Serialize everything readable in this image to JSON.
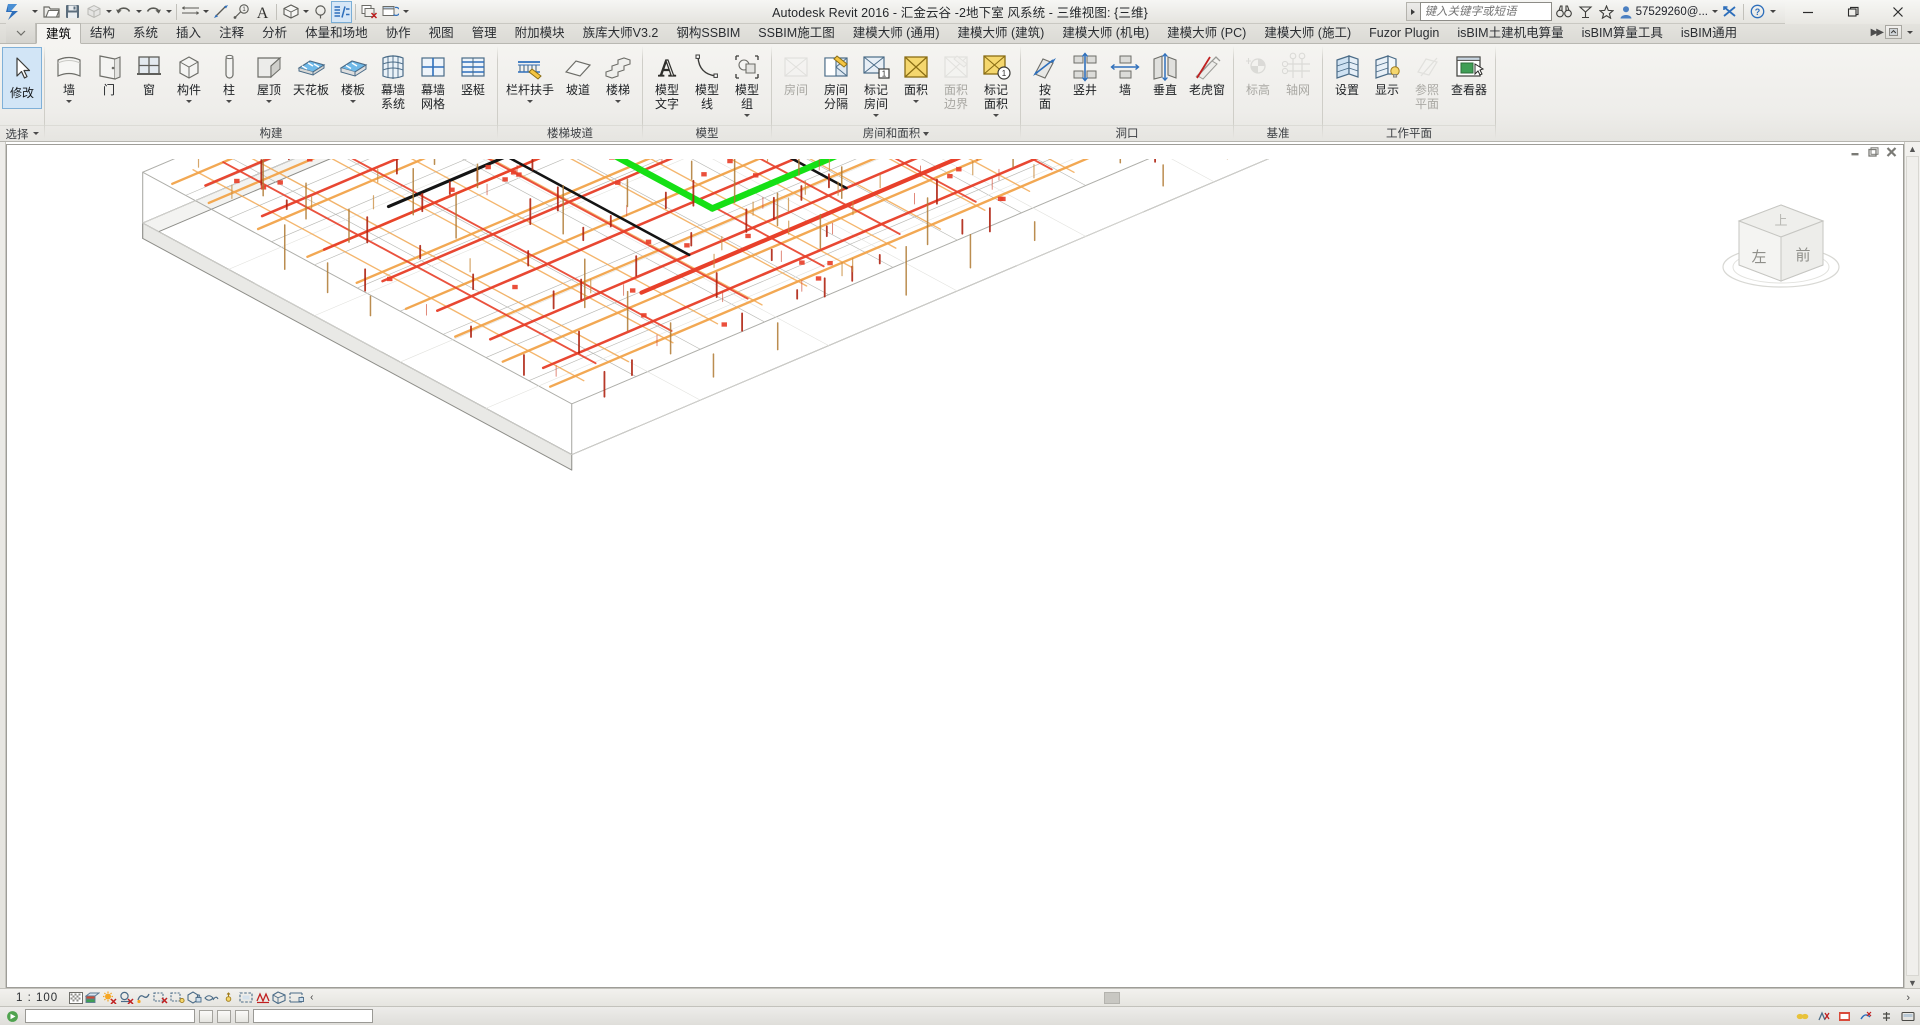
{
  "window": {
    "title": "Autodesk Revit 2016 -    汇金云谷 -2地下室  风系统 - 三维视图: {三维}",
    "app_name": "Autodesk Revit 2016",
    "document": "汇金云谷 -2地下室  风系统",
    "view": "三维视图: {三维}",
    "account": "57529260@...",
    "minimize": "—",
    "restore": "❐",
    "close": "✕"
  },
  "search": {
    "placeholder": "键入关键字或短语",
    "value": ""
  },
  "quick_access": [
    {
      "name": "open-icon",
      "label": "打开"
    },
    {
      "name": "save-icon",
      "label": "保存"
    },
    {
      "name": "export-icon",
      "label": "导出"
    },
    {
      "name": "undo-icon",
      "label": "放弃"
    },
    {
      "name": "redo-icon",
      "label": "重做"
    },
    {
      "name": "measure-icon",
      "label": "测量"
    },
    {
      "name": "aligned-dimension-icon",
      "label": "对齐尺寸标注"
    },
    {
      "name": "tag-icon",
      "label": "按类别标记"
    },
    {
      "name": "text-icon",
      "label": "文字"
    },
    {
      "name": "default-3d-view-icon",
      "label": "默认三维视图"
    },
    {
      "name": "section-icon",
      "label": "剖面"
    },
    {
      "name": "thin-lines-icon",
      "label": "细线"
    },
    {
      "name": "close-hidden-windows-icon",
      "label": "关闭隐藏窗口"
    },
    {
      "name": "switch-windows-icon",
      "label": "切换窗口"
    }
  ],
  "title_icons": [
    {
      "name": "binoculars-icon"
    },
    {
      "name": "satellite-icon"
    },
    {
      "name": "star-icon"
    },
    {
      "name": "exchange-icon"
    },
    {
      "name": "help-icon"
    }
  ],
  "tabs": [
    {
      "label": "建筑",
      "active": true
    },
    {
      "label": "结构",
      "active": false
    },
    {
      "label": "系统",
      "active": false
    },
    {
      "label": "插入",
      "active": false
    },
    {
      "label": "注释",
      "active": false
    },
    {
      "label": "分析",
      "active": false
    },
    {
      "label": "体量和场地",
      "active": false
    },
    {
      "label": "协作",
      "active": false
    },
    {
      "label": "视图",
      "active": false
    },
    {
      "label": "管理",
      "active": false
    },
    {
      "label": "附加模块",
      "active": false
    },
    {
      "label": "族库大师V3.2",
      "active": false
    },
    {
      "label": "钢构SSBIM",
      "active": false
    },
    {
      "label": "SSBIM施工图",
      "active": false
    },
    {
      "label": "建模大师 (通用)",
      "active": false
    },
    {
      "label": "建模大师 (建筑)",
      "active": false
    },
    {
      "label": "建模大师 (机电)",
      "active": false
    },
    {
      "label": "建模大师 (PC)",
      "active": false
    },
    {
      "label": "建模大师 (施工)",
      "active": false
    },
    {
      "label": "Fuzor Plugin",
      "active": false
    },
    {
      "label": "isBIM土建机电算量",
      "active": false
    },
    {
      "label": "isBIM算量工具",
      "active": false
    },
    {
      "label": "isBIM通用",
      "active": false
    }
  ],
  "select_panel": {
    "modify_label": "修改",
    "panel_title": "选择"
  },
  "ribbon_panels": [
    {
      "title": "构建",
      "buttons": [
        {
          "label": "墙",
          "icon": "wall-icon",
          "dropdown": true,
          "disabled": false
        },
        {
          "label": "门",
          "icon": "door-icon",
          "dropdown": false,
          "disabled": false
        },
        {
          "label": "窗",
          "icon": "window-icon",
          "dropdown": false,
          "disabled": false
        },
        {
          "label": "构件",
          "icon": "component-icon",
          "dropdown": true,
          "disabled": false
        },
        {
          "label": "柱",
          "icon": "column-icon",
          "dropdown": true,
          "disabled": false
        },
        {
          "label": "屋顶",
          "icon": "roof-icon",
          "dropdown": true,
          "disabled": false
        },
        {
          "label": "天花板",
          "icon": "ceiling-icon",
          "dropdown": false,
          "disabled": false
        },
        {
          "label": "楼板",
          "icon": "floor-icon",
          "dropdown": true,
          "disabled": false
        },
        {
          "label": "幕墙\n系统",
          "icon": "curtain-system-icon",
          "dropdown": false,
          "disabled": false
        },
        {
          "label": "幕墙\n网格",
          "icon": "curtain-grid-icon",
          "dropdown": false,
          "disabled": false
        },
        {
          "label": "竖梃",
          "icon": "mullion-icon",
          "dropdown": false,
          "disabled": false
        }
      ]
    },
    {
      "title": "楼梯坡道",
      "buttons": [
        {
          "label": "栏杆扶手",
          "icon": "railing-icon",
          "dropdown": true,
          "disabled": false
        },
        {
          "label": "坡道",
          "icon": "ramp-icon",
          "dropdown": false,
          "disabled": false
        },
        {
          "label": "楼梯",
          "icon": "stair-icon",
          "dropdown": true,
          "disabled": false
        }
      ]
    },
    {
      "title": "模型",
      "buttons": [
        {
          "label": "模型\n文字",
          "icon": "model-text-icon",
          "dropdown": false,
          "disabled": false
        },
        {
          "label": "模型\n线",
          "icon": "model-line-icon",
          "dropdown": false,
          "disabled": false
        },
        {
          "label": "模型\n组",
          "icon": "model-group-icon",
          "dropdown": true,
          "disabled": false
        }
      ]
    },
    {
      "title": "房间和面积",
      "has_dialog_launcher": true,
      "buttons": [
        {
          "label": "房间",
          "icon": "room-icon",
          "dropdown": false,
          "disabled": true
        },
        {
          "label": "房间\n分隔",
          "icon": "room-separator-icon",
          "dropdown": false,
          "disabled": false
        },
        {
          "label": "标记\n房间",
          "icon": "tag-room-icon",
          "dropdown": true,
          "disabled": false
        },
        {
          "label": "面积",
          "icon": "area-icon",
          "dropdown": true,
          "disabled": false
        },
        {
          "label": "面积\n边界",
          "icon": "area-boundary-icon",
          "dropdown": false,
          "disabled": true
        },
        {
          "label": "标记\n面积",
          "icon": "tag-area-icon",
          "dropdown": true,
          "disabled": false
        }
      ]
    },
    {
      "title": "洞口",
      "buttons": [
        {
          "label": "按\n面",
          "icon": "opening-by-face-icon",
          "dropdown": false,
          "disabled": false
        },
        {
          "label": "竖井",
          "icon": "shaft-icon",
          "dropdown": false,
          "disabled": false
        },
        {
          "label": "墙",
          "icon": "wall-opening-icon",
          "dropdown": false,
          "disabled": false
        },
        {
          "label": "垂直",
          "icon": "vertical-opening-icon",
          "dropdown": false,
          "disabled": false
        },
        {
          "label": "老虎窗",
          "icon": "dormer-icon",
          "dropdown": false,
          "disabled": false
        }
      ]
    },
    {
      "title": "基准",
      "buttons": [
        {
          "label": "标高",
          "icon": "level-icon",
          "dropdown": false,
          "disabled": true
        },
        {
          "label": "轴网",
          "icon": "grid-icon",
          "dropdown": false,
          "disabled": true
        }
      ]
    },
    {
      "title": "工作平面",
      "buttons": [
        {
          "label": "设置",
          "icon": "set-workplane-icon",
          "dropdown": false,
          "disabled": false
        },
        {
          "label": "显示",
          "icon": "show-workplane-icon",
          "dropdown": false,
          "disabled": false
        },
        {
          "label": "参照\n平面",
          "icon": "reference-plane-icon",
          "dropdown": false,
          "disabled": true
        },
        {
          "label": "查看器",
          "icon": "viewer-icon",
          "dropdown": false,
          "disabled": false
        }
      ]
    }
  ],
  "view_window_controls": {
    "minimize": "minimize-icon",
    "restore": "restore-icon",
    "close": "close-icon"
  },
  "view_cube": {
    "top_face": "上",
    "left_face": "左",
    "front_face": "前"
  },
  "status_bar": {
    "scale": "1 : 100",
    "icons": [
      {
        "name": "detail-level-icon"
      },
      {
        "name": "visual-style-icon"
      },
      {
        "name": "sun-path-off-icon"
      },
      {
        "name": "shadows-off-icon"
      },
      {
        "name": "render-dialog-icon"
      },
      {
        "name": "crop-region-off-icon"
      },
      {
        "name": "show-crop-region-icon"
      },
      {
        "name": "lock-3d-view-icon"
      },
      {
        "name": "temporary-hide-isolate-icon"
      },
      {
        "name": "reveal-hidden-elements-icon"
      },
      {
        "name": "temporary-view-properties-icon"
      },
      {
        "name": "hide-analytical-model-icon"
      },
      {
        "name": "reveal-constraints-icon"
      },
      {
        "name": "worksharing-display-icon"
      }
    ],
    "expand_chevron": "‹",
    "right_chevron": "›"
  }
}
